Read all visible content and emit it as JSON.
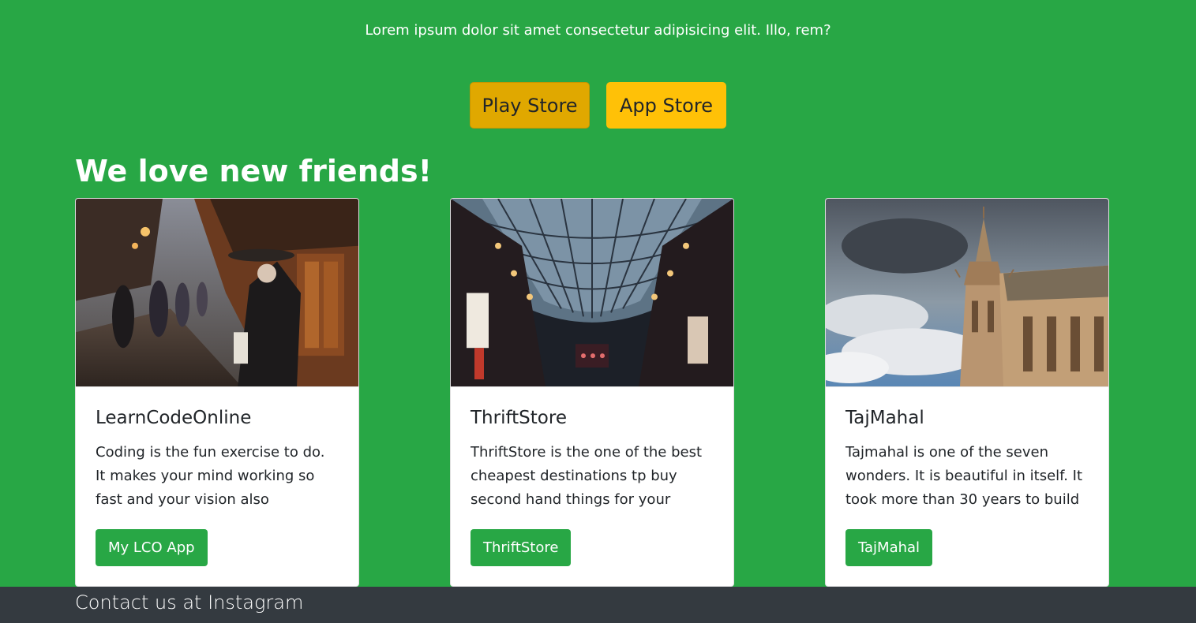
{
  "intro": {
    "text": "Lorem ipsum dolor sit amet consectetur adipisicing elit. Illo, rem?"
  },
  "store_buttons": {
    "play_store": "Play Store",
    "app_store": "App Store"
  },
  "section": {
    "title": "We love new friends!"
  },
  "cards": [
    {
      "title": "LearnCodeOnline",
      "text": "Coding is the fun exercise to do. It makes your mind working so fast and your vision also",
      "button": "My LCO App"
    },
    {
      "title": "ThriftStore",
      "text": "ThriftStore is the one of the best cheapest destinations tp buy second hand things for your home",
      "button": "ThriftStore"
    },
    {
      "title": "TajMahal",
      "text": "Tajmahal is one of the seven wonders. It is beautiful in itself. It took more than 30 years to build",
      "button": "TajMahal"
    }
  ],
  "footer": {
    "text": "Contact us at Instagram"
  },
  "colors": {
    "page_background": "#28a745",
    "play_store_button": "#e0a800",
    "app_store_button": "#ffc107",
    "card_button": "#28a745",
    "footer_background": "#343a40"
  }
}
